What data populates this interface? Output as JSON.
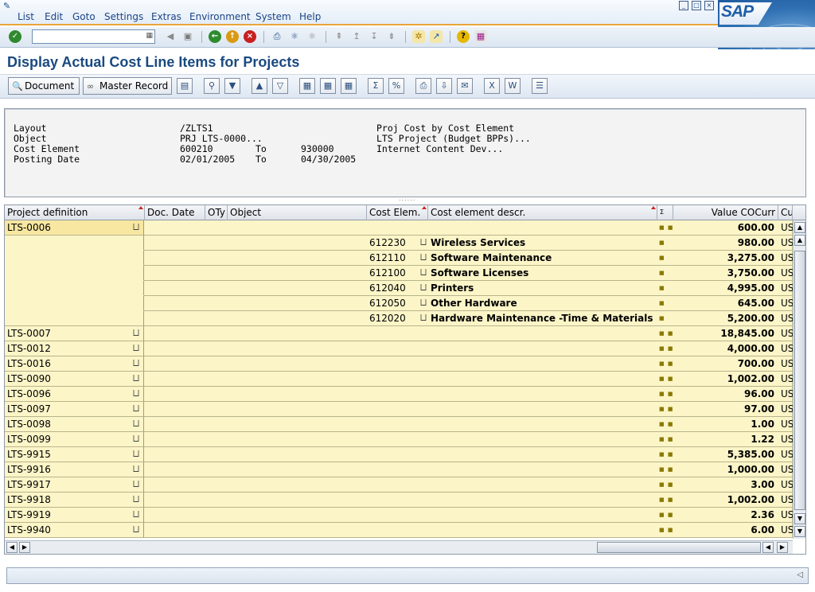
{
  "menu": {
    "items": [
      "List",
      "Edit",
      "Goto",
      "Settings",
      "Extras",
      "Environment",
      "System",
      "Help"
    ]
  },
  "window": {
    "logo_text": "SAP"
  },
  "toolbar": {
    "command_field": "",
    "icons": [
      "enter-icon",
      "back-icon",
      "exit-icon",
      "cancel-icon",
      "print-icon",
      "find-icon",
      "find-next-icon",
      "first-page-icon",
      "previous-page-icon",
      "next-page-icon",
      "last-page-icon",
      "new-session-icon",
      "create-shortcut-icon",
      "help-icon",
      "customize-layout-icon"
    ]
  },
  "page": {
    "title": "Display Actual Cost Line Items for Projects"
  },
  "app_toolbar": {
    "document_label": "Document",
    "master_record_label": "Master Record"
  },
  "header": {
    "rows": [
      {
        "label": "Layout",
        "value": "/ZLTS1",
        "to_label": "",
        "to_value": "",
        "desc": "Proj Cost by Cost Element"
      },
      {
        "label": "Object",
        "value": "PRJ LTS-0000...",
        "to_label": "",
        "to_value": "",
        "desc": "LTS Project (Budget BPPs)..."
      },
      {
        "label": "Cost Element",
        "value": "600210",
        "to_label": "To",
        "to_value": "930000",
        "desc": "Internet Content Dev..."
      },
      {
        "label": "Posting Date",
        "value": "02/01/2005",
        "to_label": "To",
        "to_value": "04/30/2005",
        "desc": ""
      }
    ]
  },
  "grid": {
    "columns": [
      "Project definition",
      "Doc. Date",
      "OTy",
      "Object",
      "Cost Elem.",
      "Cost element descr.",
      "Σ",
      "Value COCurr",
      "Cu"
    ],
    "rows": [
      {
        "project": "LTS-0006",
        "cost_elem": "",
        "descr": "",
        "value": "600.00",
        "curr": "USD",
        "dots": 2,
        "level": 0
      },
      {
        "project": "",
        "cost_elem": "612230",
        "descr": "Wireless Services",
        "value": "980.00",
        "curr": "USD",
        "dots": 1,
        "level": 1
      },
      {
        "project": "",
        "cost_elem": "612110",
        "descr": "Software Maintenance",
        "value": "3,275.00",
        "curr": "USD",
        "dots": 1,
        "level": 1
      },
      {
        "project": "",
        "cost_elem": "612100",
        "descr": "Software Licenses",
        "value": "3,750.00",
        "curr": "USD",
        "dots": 1,
        "level": 1
      },
      {
        "project": "",
        "cost_elem": "612040",
        "descr": "Printers",
        "value": "4,995.00",
        "curr": "USD",
        "dots": 1,
        "level": 1
      },
      {
        "project": "",
        "cost_elem": "612050",
        "descr": "Other Hardware",
        "value": "645.00",
        "curr": "USD",
        "dots": 1,
        "level": 1
      },
      {
        "project": "",
        "cost_elem": "612020",
        "descr": "Hardware Maintenance -Time & Materials",
        "value": "5,200.00",
        "curr": "USD",
        "dots": 1,
        "level": 1
      },
      {
        "project": "LTS-0007",
        "cost_elem": "",
        "descr": "",
        "value": "18,845.00",
        "curr": "USD",
        "dots": 2,
        "level": 0
      },
      {
        "project": "LTS-0012",
        "cost_elem": "",
        "descr": "",
        "value": "4,000.00",
        "curr": "USD",
        "dots": 2,
        "level": 0
      },
      {
        "project": "LTS-0016",
        "cost_elem": "",
        "descr": "",
        "value": "700.00",
        "curr": "USD",
        "dots": 2,
        "level": 0
      },
      {
        "project": "LTS-0090",
        "cost_elem": "",
        "descr": "",
        "value": "1,002.00",
        "curr": "USD",
        "dots": 2,
        "level": 0
      },
      {
        "project": "LTS-0096",
        "cost_elem": "",
        "descr": "",
        "value": "96.00",
        "curr": "USD",
        "dots": 2,
        "level": 0
      },
      {
        "project": "LTS-0097",
        "cost_elem": "",
        "descr": "",
        "value": "97.00",
        "curr": "USD",
        "dots": 2,
        "level": 0
      },
      {
        "project": "LTS-0098",
        "cost_elem": "",
        "descr": "",
        "value": "1.00",
        "curr": "USD",
        "dots": 2,
        "level": 0
      },
      {
        "project": "LTS-0099",
        "cost_elem": "",
        "descr": "",
        "value": "1.22",
        "curr": "USD",
        "dots": 2,
        "level": 0
      },
      {
        "project": "LTS-9915",
        "cost_elem": "",
        "descr": "",
        "value": "5,385.00",
        "curr": "USD",
        "dots": 2,
        "level": 0
      },
      {
        "project": "LTS-9916",
        "cost_elem": "",
        "descr": "",
        "value": "1,000.00",
        "curr": "USD",
        "dots": 2,
        "level": 0
      },
      {
        "project": "LTS-9917",
        "cost_elem": "",
        "descr": "",
        "value": "3.00",
        "curr": "USD",
        "dots": 2,
        "level": 0
      },
      {
        "project": "LTS-9918",
        "cost_elem": "",
        "descr": "",
        "value": "1,002.00",
        "curr": "USD",
        "dots": 2,
        "level": 0
      },
      {
        "project": "LTS-9919",
        "cost_elem": "",
        "descr": "",
        "value": "2.36",
        "curr": "USD",
        "dots": 2,
        "level": 0
      },
      {
        "project": "LTS-9940",
        "cost_elem": "",
        "descr": "",
        "value": "6.00",
        "curr": "USD",
        "dots": 2,
        "level": 0
      }
    ]
  },
  "status_bar": {
    "text": ""
  },
  "colors": {
    "row_bg": "#fbf5c8",
    "selected_bg": "#f8e7a1",
    "title": "#1a4a80",
    "accent": "#e9a53a"
  }
}
